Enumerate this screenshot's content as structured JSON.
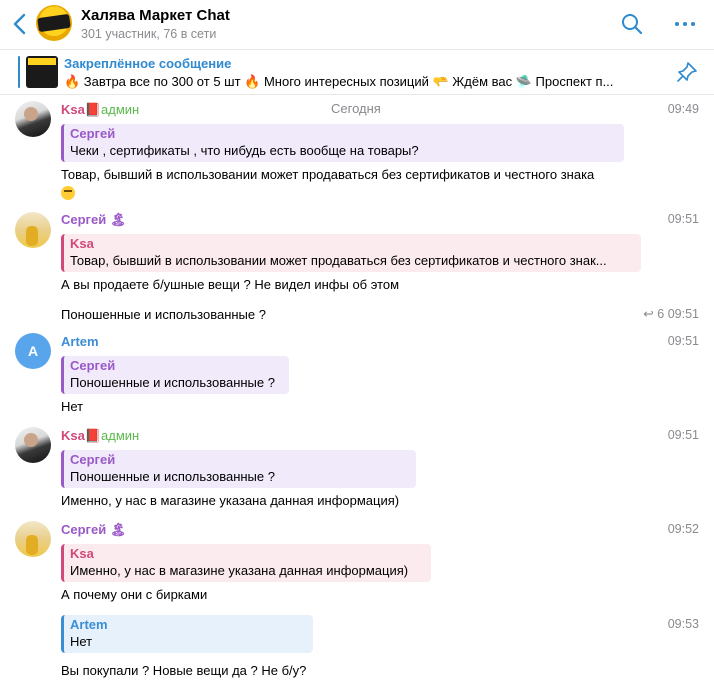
{
  "header": {
    "title": "Халява Маркет Chat",
    "subtitle": "301 участник, 76 в сети"
  },
  "pinned": {
    "title": "Закреплённое сообщение",
    "text": "🔥 Завтра все по 300 от 5 шт 🔥  Много интересных позиций 🫳  Ждём вас 🛸  Проспект п..."
  },
  "date": "Сегодня",
  "messages": [
    {
      "sender": "Ksa",
      "sender_suffix": "📕",
      "badge": "админ",
      "time": "09:49",
      "reply": {
        "name": "Сергей",
        "text": "Чеки , сертификаты , что нибудь есть вообще на товары?"
      },
      "text": "Товар, бывший в использовании может продаваться без сертификатов и честного знака"
    },
    {
      "sender": "Сергей",
      "sender_suffix": "🏝",
      "time": "09:51",
      "reply": {
        "name": "Ksa",
        "text": "Товар, бывший в использовании может продаваться без сертификатов и честного знак..."
      },
      "text": "А вы продаете б/ушные вещи ? Не видел инфы об этом"
    },
    {
      "text": "Поношенные и использованные ?",
      "reply_count": "6",
      "time": "09:51"
    },
    {
      "sender": "Artem",
      "avatar_letter": "A",
      "time": "09:51",
      "reply": {
        "name": "Сергей",
        "text": "Поношенные и использованные ?"
      },
      "text": "Нет"
    },
    {
      "sender": "Ksa",
      "sender_suffix": "📕",
      "badge": "админ",
      "time": "09:51",
      "reply": {
        "name": "Сергей",
        "text": "Поношенные и использованные ?"
      },
      "text": "Именно, у нас в магазине указана данная информация)"
    },
    {
      "sender": "Сергей",
      "sender_suffix": "🏝",
      "time": "09:52",
      "reply": {
        "name": "Ksa",
        "text": "Именно, у нас в магазине указана данная информация)"
      },
      "text": "А почему они с бирками"
    },
    {
      "time": "09:53",
      "reply": {
        "name": "Artem",
        "text": "Нет"
      },
      "text": "Вы покупали ? Новые вещи да ? Не б/у?"
    }
  ],
  "icons": {
    "back": "chevron-left-icon",
    "search": "search-icon",
    "more": "more-horizontal-icon",
    "pin": "pin-list-icon"
  },
  "colors": {
    "accent": "#2f8ad0",
    "ksa": "#d1487a",
    "sergey": "#9b59c8",
    "artem": "#3c8ed4",
    "admin_badge": "#5bb94b"
  }
}
